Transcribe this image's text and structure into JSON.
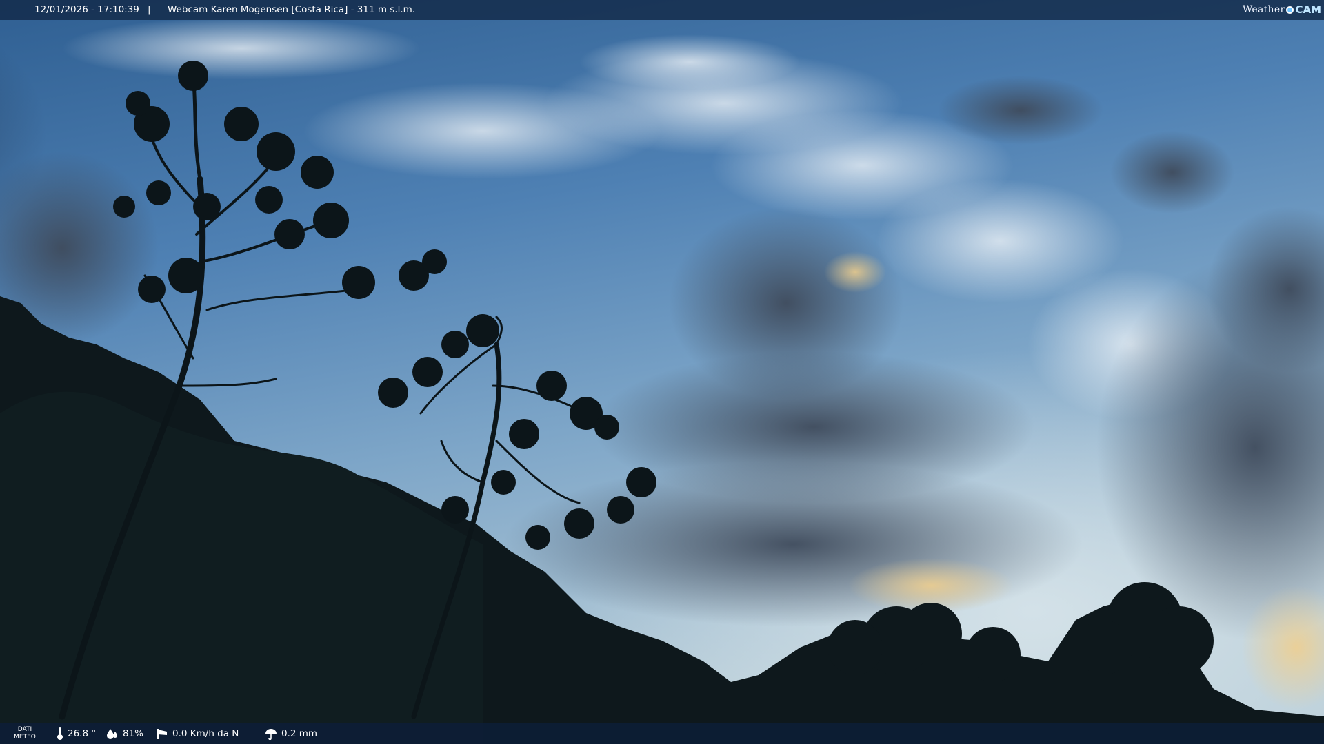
{
  "header": {
    "datetime": "12/01/2026 - 17:10:39",
    "separator": "|",
    "title_prefix": "Webcam ",
    "title_name": "Karen Mogensen [Costa Rica]",
    "title_altitude": " - 311 m s.l.m.",
    "logo_weather": "Weather",
    "logo_cam": "CAM"
  },
  "weather": {
    "panel_label_top": "DATI",
    "panel_label_bottom": "METEO",
    "temperature": "26.8 °",
    "humidity": "81%",
    "wind": "0.0 Km/h da N",
    "rain": "0.2 mm"
  },
  "icons": [
    "thermometer-icon",
    "humidity-drops-icon",
    "windsock-icon",
    "rain-umbrella-icon",
    "weathercam-logo-icon"
  ],
  "colors": {
    "sky_top": "#3a6a9c",
    "sky_mid": "#6a98c4",
    "sky_horizon": "#c9dbe6",
    "cloud_dark": "#4d5c70",
    "cloud_light": "#e8eef3",
    "sunset_glow": "#e8c88a",
    "foliage": "#0f1a1d",
    "bar_bg": "#122a48"
  }
}
